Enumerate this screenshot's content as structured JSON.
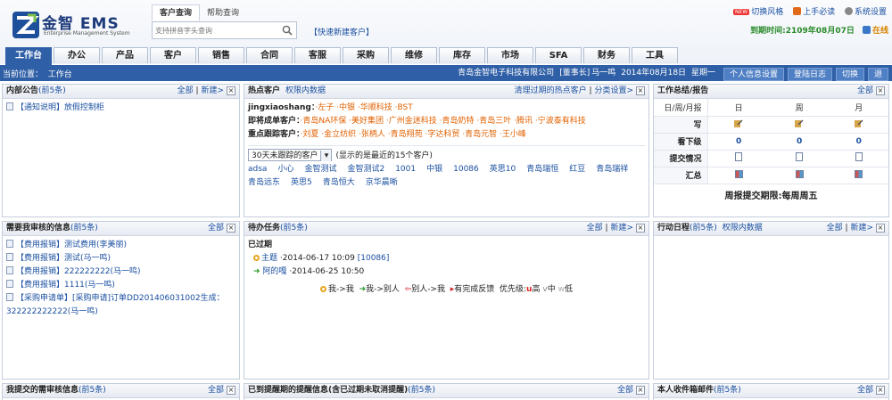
{
  "header": {
    "logo_title": "金智 EMS",
    "logo_subtitle": "Enterprise Management System",
    "search_tabs": [
      "客户查询",
      "帮助查询"
    ],
    "search_placeholder": "支持拼音字头查询",
    "quick_new_customer": "【快速新建客户】",
    "top_links": {
      "new_badge": "NEW",
      "switch_style": "切换风格",
      "must_read": "上手必读",
      "settings": "系统设置"
    },
    "expire_text": "到期时间:2109年08月07日",
    "offline": "在线"
  },
  "nav_tabs": [
    "工作台",
    "办公",
    "产品",
    "客户",
    "销售",
    "合同",
    "客服",
    "采购",
    "维修",
    "库存",
    "市场",
    "SFA",
    "财务",
    "工具"
  ],
  "status": {
    "location_label": "当前位置：",
    "location": "工作台",
    "company": "青岛金智电子科技有限公司",
    "role": "[董事长]",
    "user": "马一鸣",
    "date": "2014年08月18日",
    "weekday": "星期一",
    "buttons": [
      "个人信息设置",
      "登陆日志",
      "切换",
      "退"
    ]
  },
  "panels": {
    "notice": {
      "title": "内部公告",
      "count": "(前5条)",
      "links": [
        "全部",
        "|",
        "新建>"
      ],
      "items": [
        "【通知说明】放假控制柜"
      ]
    },
    "hot_customers": {
      "title": "热点客户",
      "sub": "权限内数据",
      "right_links": [
        "清理过期的热点客户",
        "|",
        "分类设置>"
      ],
      "owner": "jingxiaoshang：",
      "owner_items": [
        "·左子",
        "·中银",
        "·华顺科技",
        "·BST"
      ],
      "deal_label": "即将成单客户：",
      "deal_items": [
        "·青岛NA环保",
        "·美好集团",
        "·广州金迷科技",
        "·青岛奶特",
        "·青岛三叶",
        "·腾讯",
        "·宁波泰有科技"
      ],
      "track_label": "重点跟踪客户：",
      "track_items": [
        "·刘夏",
        "·金立纺织",
        "·张柄人",
        "·青岛翔苑",
        "·字达科贸",
        "·青岛元智",
        "·王小峰"
      ],
      "select_value": "30天未跟踪的客户",
      "select_hint": "(显示的是最近的15个客户)",
      "customer_list": [
        "adsa",
        "小心",
        "金智测试",
        "金智测试2",
        "1001",
        "中银",
        "10086",
        "英思10",
        "青岛瑞恒",
        "红豆",
        "青岛瑞祥",
        "青岛远东",
        "英思5",
        "青岛恒大",
        "京华晨晰"
      ]
    },
    "work_report": {
      "title": "工作总结/报告",
      "links": [
        "全部"
      ],
      "col_header": "日/周/月报",
      "cols": [
        "日",
        "周",
        "月"
      ],
      "rows": [
        {
          "label": "写",
          "kind": "write"
        },
        {
          "label": "看下级",
          "values": [
            "0",
            "0",
            "0"
          ]
        },
        {
          "label": "提交情况",
          "kind": "doc"
        },
        {
          "label": "汇总",
          "kind": "grid"
        }
      ],
      "period": "周报提交期限:每周周五"
    },
    "approve": {
      "title": "需要我审核的信息",
      "count": "(前5条)",
      "links": [
        "全部"
      ],
      "items": [
        "【费用报销】测试费用(李美丽)",
        "【费用报销】测试(马一鸣)",
        "【费用报销】222222222(马一鸣)",
        "【费用报销】1111(马一鸣)",
        "【采购申请单】[采购申请]订单DD201406031002生成：",
        "322222222222(马一鸣)"
      ]
    },
    "todo": {
      "title": "待办任务",
      "count": "(前5条)",
      "links": [
        "全部",
        "|",
        "新建>"
      ],
      "expired_label": "已过期",
      "tasks": [
        {
          "name": "主题",
          "date": "·2014-06-17 10:09",
          "extra": "[10086]"
        },
        {
          "name": "阿的嘎",
          "date": "·2014-06-25 10:50",
          "extra": ""
        }
      ],
      "legend": [
        "我->我",
        "我->别人",
        "别人->我",
        "有完成反馈",
        "优先级:"
      ],
      "priority": [
        "高",
        "中",
        "低"
      ]
    },
    "schedule": {
      "title": "行动日程",
      "count": "(前5条)",
      "sub": "权限内数据",
      "links": [
        "全部",
        "|",
        "新建>"
      ]
    },
    "submitted": {
      "title": "我提交的需审核信息",
      "count": "(前5条)",
      "links": [
        "全部"
      ]
    },
    "reminder": {
      "title": "已到提醒期的提醒信息(含已过期未取消提醒)",
      "count": "(前5条)",
      "links": [
        "全部"
      ]
    },
    "mail": {
      "title": "本人收件箱邮件",
      "count": "(前5条)",
      "links": [
        "全部"
      ]
    }
  },
  "colors": {
    "nav_active": "#2f5fa6",
    "link": "#1a4fa0",
    "hot_orange": "#e26100",
    "expire_green": "#2a8a2a"
  },
  "icons": [
    "search-icon",
    "close-icon",
    "document-icon",
    "pencil-icon",
    "grid-icon",
    "arrow-right-icon",
    "dot-icon"
  ]
}
